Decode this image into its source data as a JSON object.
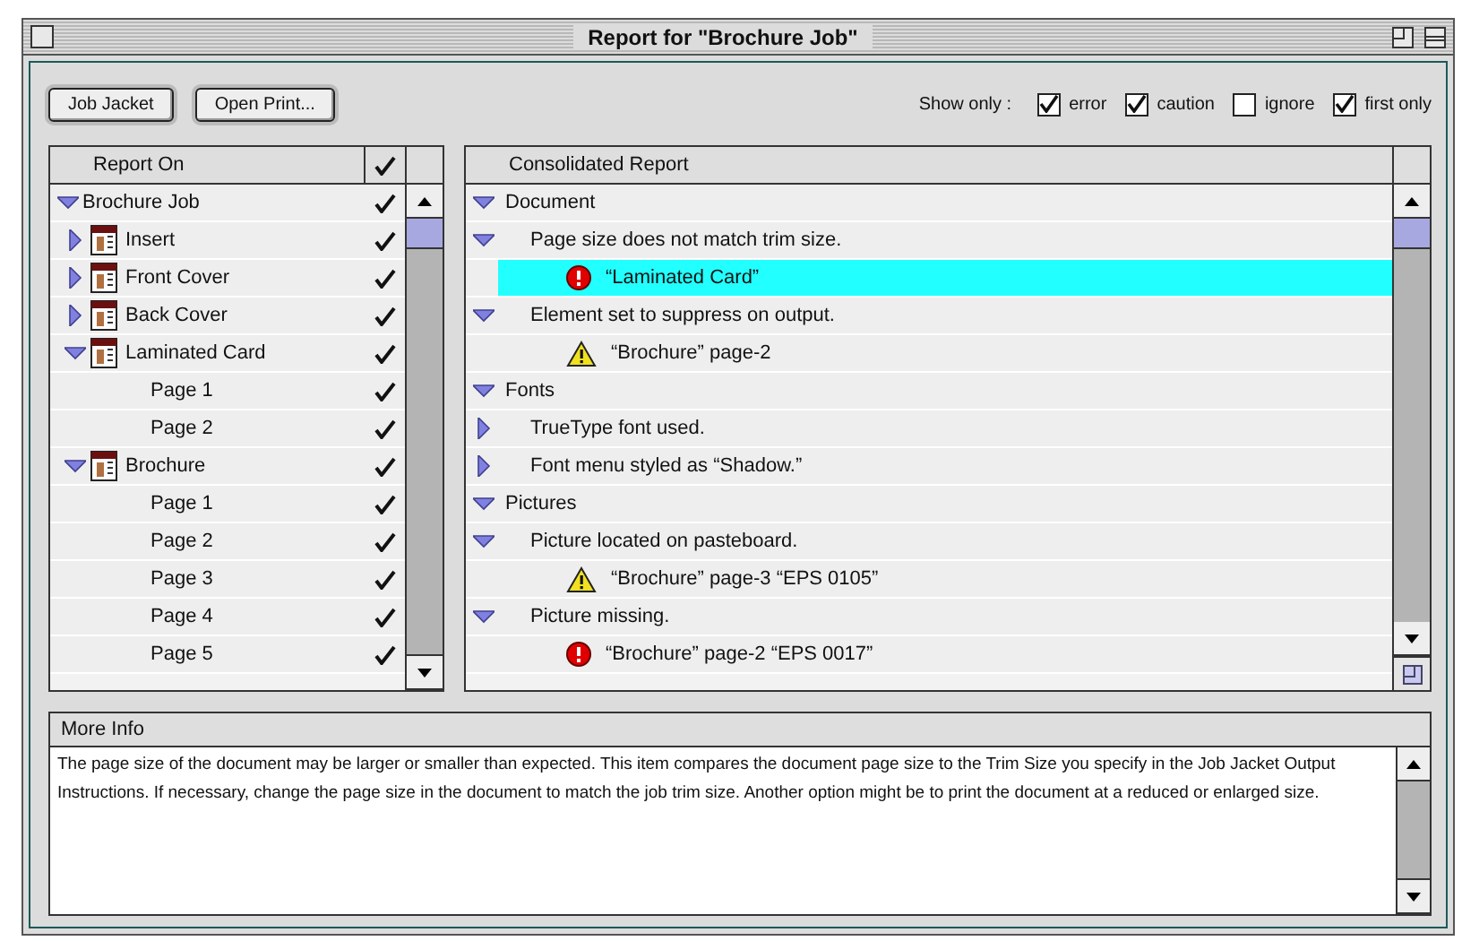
{
  "window": {
    "title": "Report for \"Brochure Job\""
  },
  "toolbar": {
    "buttons": [
      "Job Jacket",
      "Open Print..."
    ],
    "filter_label": "Show only :",
    "filters": [
      {
        "label": "error",
        "checked": true
      },
      {
        "label": "caution",
        "checked": true
      },
      {
        "label": "ignore",
        "checked": false
      },
      {
        "label": "first only",
        "checked": true
      }
    ]
  },
  "report_on": {
    "column": "Report On",
    "items": [
      {
        "label": "Brochure Job",
        "expanded": true,
        "checked": true,
        "children": [
          {
            "label": "Insert",
            "kind": "layout",
            "expanded": false,
            "checked": true
          },
          {
            "label": "Front Cover",
            "kind": "layout",
            "expanded": false,
            "checked": true
          },
          {
            "label": "Back Cover",
            "kind": "layout",
            "expanded": false,
            "checked": true
          },
          {
            "label": "Laminated Card",
            "kind": "layout",
            "expanded": true,
            "checked": true,
            "children": [
              {
                "label": "Page 1",
                "checked": true
              },
              {
                "label": "Page 2",
                "checked": true
              }
            ]
          },
          {
            "label": "Brochure",
            "kind": "layout",
            "expanded": true,
            "checked": true,
            "children": [
              {
                "label": "Page 1",
                "checked": true
              },
              {
                "label": "Page 2",
                "checked": true
              },
              {
                "label": "Page 3",
                "checked": true
              },
              {
                "label": "Page 4",
                "checked": true
              },
              {
                "label": "Page 5",
                "checked": true
              }
            ]
          }
        ]
      }
    ]
  },
  "consolidated_report": {
    "column": "Consolidated Report",
    "items": [
      {
        "label": "Document",
        "kind": "category",
        "expanded": true,
        "selected": false,
        "children": [
          {
            "label": "Page size does not match trim size.",
            "kind": "issue",
            "expanded": true,
            "selected": false,
            "children": [
              {
                "label": "“Laminated Card”",
                "kind": "error",
                "selected": true
              }
            ]
          },
          {
            "label": "Element set to suppress on output.",
            "kind": "issue",
            "expanded": true,
            "selected": false,
            "children": [
              {
                "label": "“Brochure” page-2",
                "kind": "caution",
                "selected": false
              }
            ]
          }
        ]
      },
      {
        "label": "Fonts",
        "kind": "category",
        "expanded": true,
        "selected": false,
        "children": [
          {
            "label": "TrueType font used.",
            "kind": "issue",
            "expanded": false,
            "selected": false
          },
          {
            "label": "Font menu styled as “Shadow.”",
            "kind": "issue",
            "expanded": false,
            "selected": false
          }
        ]
      },
      {
        "label": "Pictures",
        "kind": "category",
        "expanded": true,
        "selected": false,
        "children": [
          {
            "label": "Picture located on pasteboard.",
            "kind": "issue",
            "expanded": true,
            "selected": false,
            "children": [
              {
                "label": "“Brochure” page-3 “EPS 0105”",
                "kind": "caution",
                "selected": false
              }
            ]
          },
          {
            "label": "Picture missing.",
            "kind": "issue",
            "expanded": true,
            "selected": false,
            "children": [
              {
                "label": "“Brochure” page-2 “EPS 0017”",
                "kind": "error",
                "selected": false
              }
            ]
          }
        ]
      }
    ]
  },
  "more_info": {
    "title": "More Info",
    "text": "The page size of the document may be larger or smaller than expected.  This item compares the document page size to the Trim Size you specify in the Job Jacket Output Instructions. If necessary, change the page size in the document to match the job trim size. Another option might be to print the document at a reduced or enlarged size."
  }
}
